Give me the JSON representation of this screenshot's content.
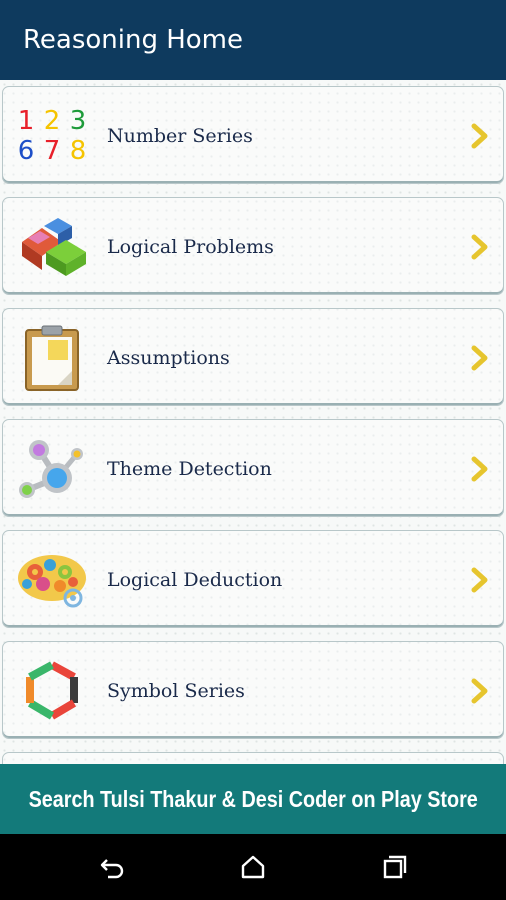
{
  "app": {
    "title": "Reasoning Home"
  },
  "menu": {
    "items": [
      {
        "label": "Number Series",
        "icon": "number-grid-icon",
        "digits": [
          "1",
          "2",
          "3",
          "6",
          "7",
          "8"
        ],
        "digit_colors": [
          "#e8202a",
          "#f5c400",
          "#1e9b3a",
          "#1d4fc8",
          "#e8202a",
          "#f5c400"
        ]
      },
      {
        "label": "Logical Problems",
        "icon": "puzzle-blocks-icon"
      },
      {
        "label": "Assumptions",
        "icon": "clipboard-icon"
      },
      {
        "label": "Theme Detection",
        "icon": "molecule-nodes-icon"
      },
      {
        "label": "Logical Deduction",
        "icon": "brain-gears-icon"
      },
      {
        "label": "Symbol Series",
        "icon": "hexagon-ring-icon"
      }
    ]
  },
  "banner": {
    "text": "Search Tulsi Thakur & Desi Coder on Play Store"
  },
  "colors": {
    "appbar": "#0e3a5e",
    "banner": "#137a7a",
    "chevron": "#e6c52e"
  }
}
